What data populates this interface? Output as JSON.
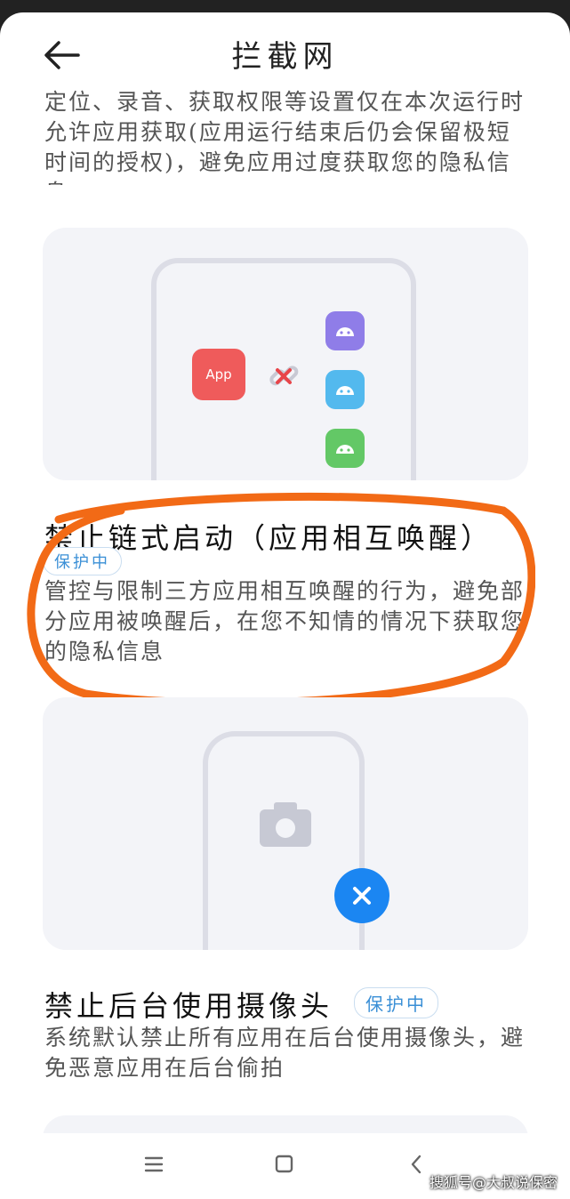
{
  "header": {
    "title": "拦截网"
  },
  "intro": {
    "text": "定位、录音、获取权限等设置仅在本次运行时允许应用获取(应用运行结束后仍会保留极短时间的授权)，避免应用过度获取您的隐私信息"
  },
  "chain_start": {
    "illustration": {
      "app_label": "App"
    },
    "title": "禁止链式启动（应用相互唤醒）",
    "badge": "保护中",
    "description": "管控与限制三方应用相互唤醒的行为，避免部分应用被唤醒后，在您不知情的情况下获取您的隐私信息"
  },
  "camera": {
    "title": "禁止后台使用摄像头",
    "badge": "保护中",
    "description": "系统默认禁止所有应用在后台使用摄像头，避免恶意应用在后台偷拍"
  },
  "watermark": "搜狐号@大叔说保密",
  "colors": {
    "accent": "#1b86f2",
    "highlight": "#f26a16",
    "app_tile": "#ef5b5b",
    "android_purple": "#8f7de8",
    "android_blue": "#53b9ee",
    "android_green": "#63c866"
  },
  "icons": {
    "back": "arrow-left-icon",
    "link": "broken-link-icon",
    "camera": "camera-icon",
    "close": "close-icon",
    "nav_menu": "menu-icon",
    "nav_home": "square-icon",
    "nav_back": "chevron-left-icon"
  }
}
